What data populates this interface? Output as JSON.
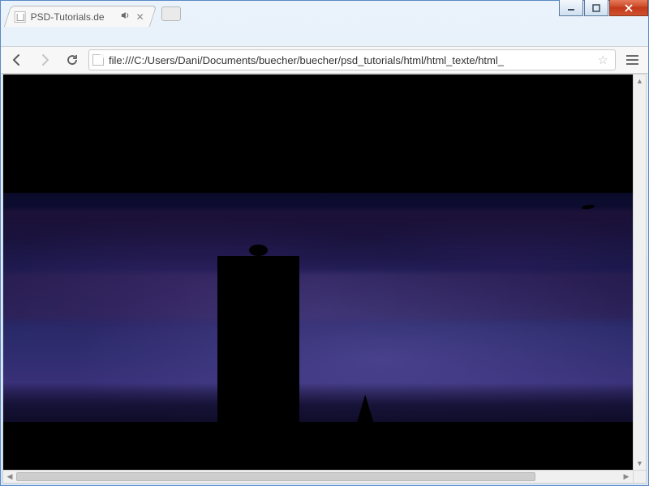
{
  "window": {
    "title": "PSD-Tutorials.de"
  },
  "tab": {
    "title": "PSD-Tutorials.de"
  },
  "address": {
    "url": "file:///C:/Users/Dani/Documents/buecher/buecher/psd_tutorials/html/html_texte/html_"
  }
}
